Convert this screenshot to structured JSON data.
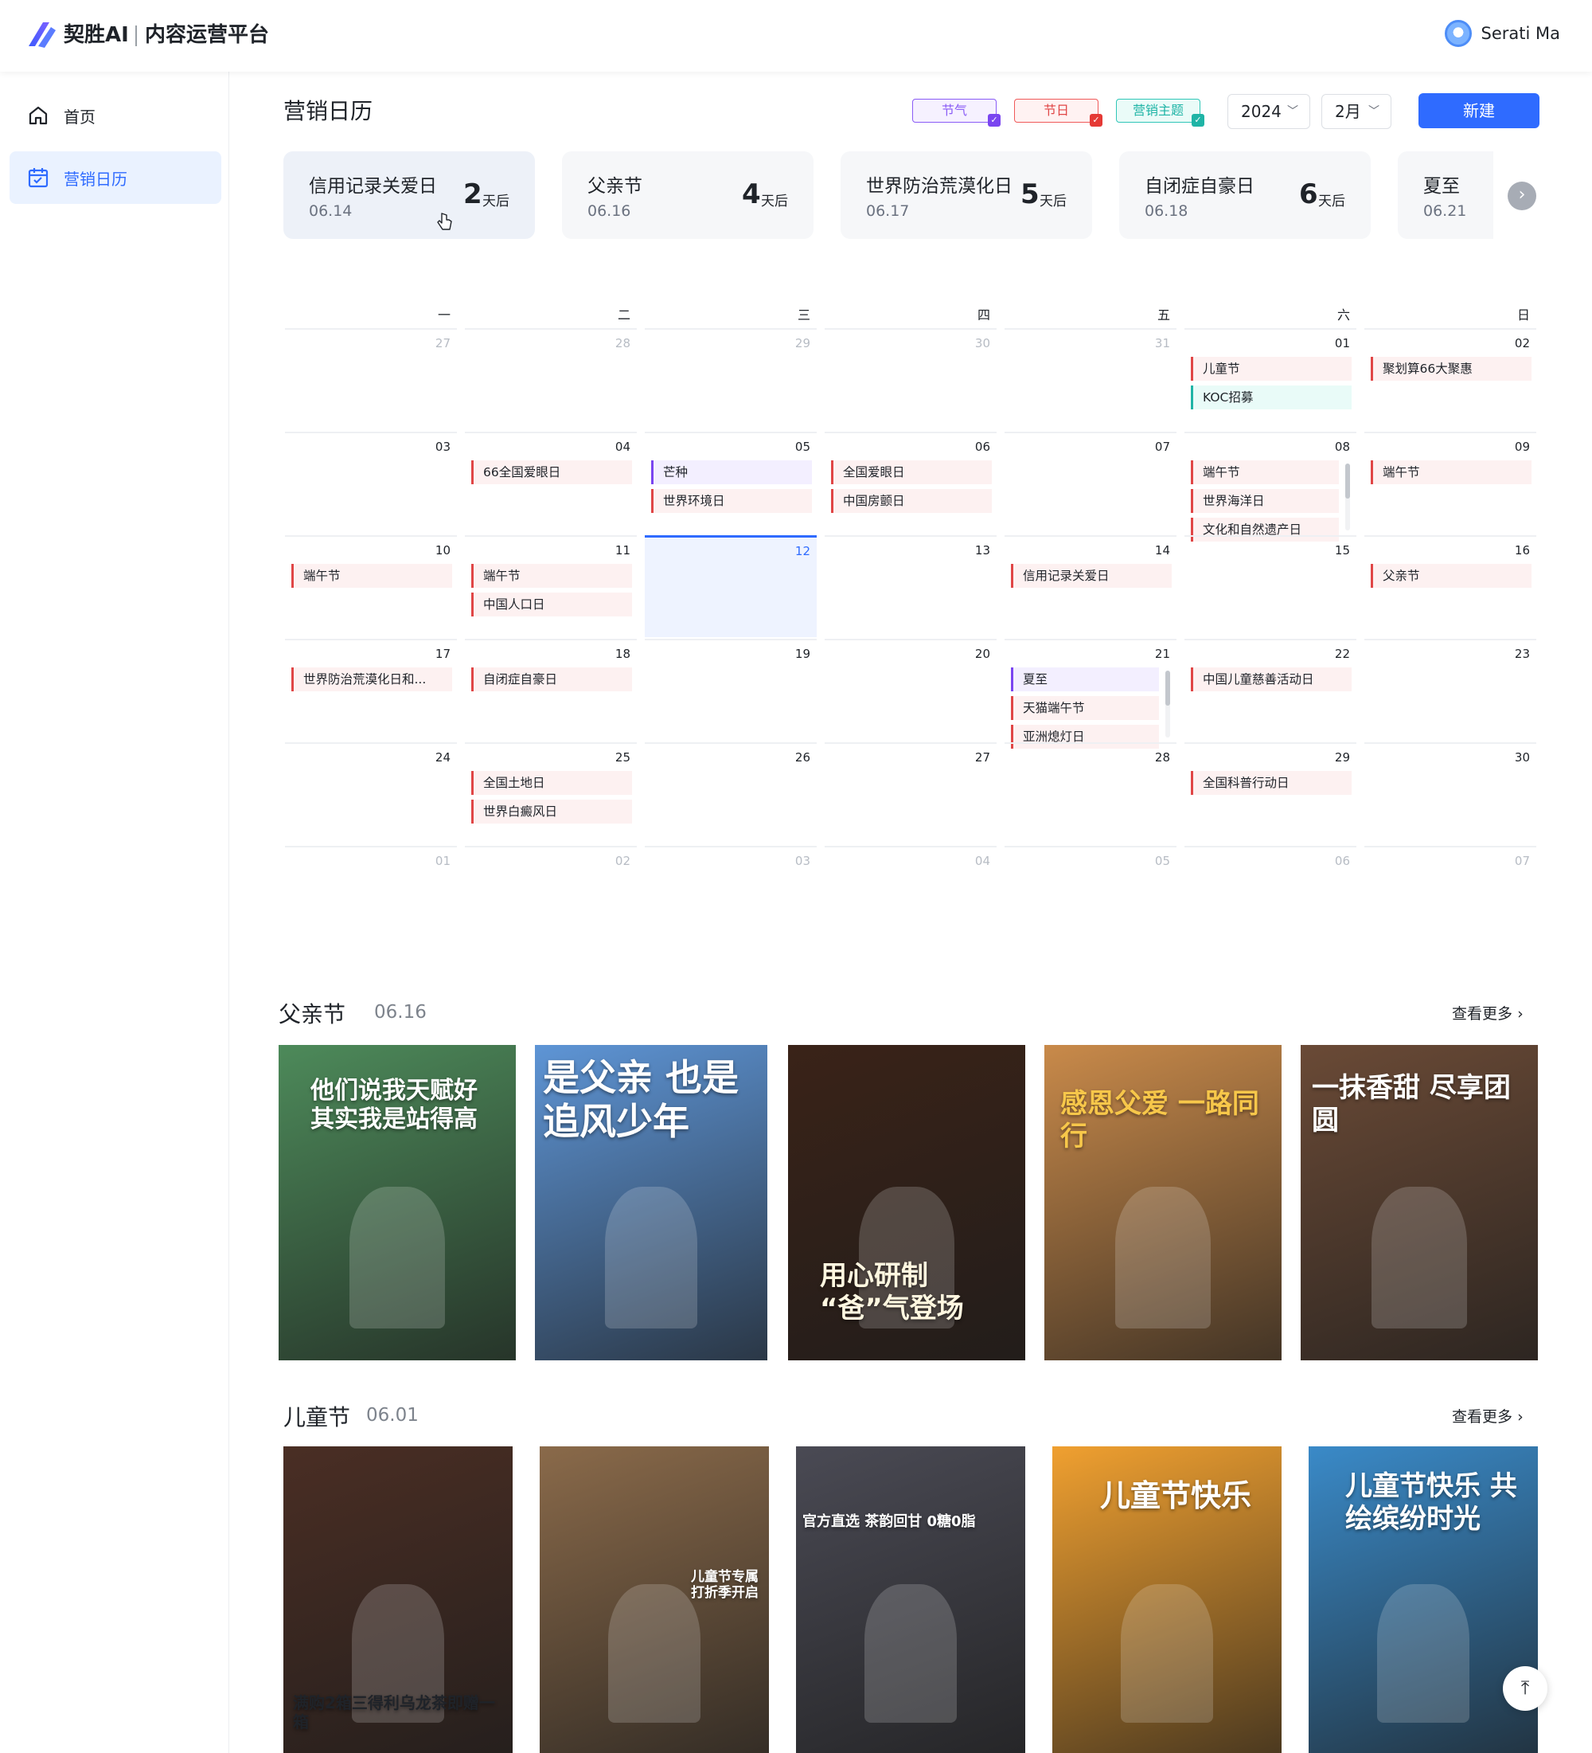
{
  "header": {
    "brand": "契胜AI",
    "platform": "内容运营平台",
    "user_name": "Serati Ma"
  },
  "sidebar": {
    "items": [
      {
        "label": "首页",
        "icon": "home-icon"
      },
      {
        "label": "营销日历",
        "icon": "calendar-icon",
        "active": true
      }
    ]
  },
  "page": {
    "title": "营销日历",
    "legend": [
      {
        "label": "节气",
        "color": "#7a45f0"
      },
      {
        "label": "节日",
        "color": "#e53935"
      },
      {
        "label": "营销主题",
        "color": "#1fb4a6"
      }
    ],
    "year": "2024",
    "month": "2月",
    "new_button": "新建"
  },
  "countdown": [
    {
      "name": "信用记录关爱日",
      "date": "06.14",
      "days": "2",
      "unit": "天后"
    },
    {
      "name": "父亲节",
      "date": "06.16",
      "days": "4",
      "unit": "天后"
    },
    {
      "name": "世界防治荒漠化日",
      "date": "06.17",
      "days": "5",
      "unit": "天后"
    },
    {
      "name": "自闭症自豪日",
      "date": "06.18",
      "days": "6",
      "unit": "天后"
    },
    {
      "name": "夏至",
      "date": "06.21",
      "days": "",
      "unit": ""
    }
  ],
  "calendar": {
    "weekdays": [
      "一",
      "二",
      "三",
      "四",
      "五",
      "六",
      "日"
    ],
    "weeks": [
      [
        {
          "day": "27",
          "other": true,
          "events": []
        },
        {
          "day": "28",
          "other": true,
          "events": []
        },
        {
          "day": "29",
          "other": true,
          "events": []
        },
        {
          "day": "30",
          "other": true,
          "events": []
        },
        {
          "day": "31",
          "other": true,
          "events": []
        },
        {
          "day": "01",
          "events": [
            {
              "t": "儿童节",
              "c": "red"
            },
            {
              "t": "KOC招募",
              "c": "teal"
            }
          ]
        },
        {
          "day": "02",
          "events": [
            {
              "t": "聚划算66大聚惠",
              "c": "red"
            }
          ]
        }
      ],
      [
        {
          "day": "03",
          "events": []
        },
        {
          "day": "04",
          "events": [
            {
              "t": "66全国爱眼日",
              "c": "red"
            }
          ]
        },
        {
          "day": "05",
          "events": [
            {
              "t": "芒种",
              "c": "purple"
            },
            {
              "t": "世界环境日",
              "c": "red"
            }
          ]
        },
        {
          "day": "06",
          "events": [
            {
              "t": "全国爱眼日",
              "c": "red"
            },
            {
              "t": "中国房颤日",
              "c": "red"
            }
          ]
        },
        {
          "day": "07",
          "events": []
        },
        {
          "day": "08",
          "scroll": true,
          "events": [
            {
              "t": "端午节",
              "c": "red"
            },
            {
              "t": "世界海洋日",
              "c": "red"
            },
            {
              "t": "文化和自然遗产日",
              "c": "red"
            }
          ]
        },
        {
          "day": "09",
          "events": [
            {
              "t": "端午节",
              "c": "red"
            }
          ]
        }
      ],
      [
        {
          "day": "10",
          "events": [
            {
              "t": "端午节",
              "c": "red"
            }
          ]
        },
        {
          "day": "11",
          "events": [
            {
              "t": "端午节",
              "c": "red"
            },
            {
              "t": "中国人口日",
              "c": "red"
            }
          ]
        },
        {
          "day": "12",
          "today": true,
          "events": []
        },
        {
          "day": "13",
          "events": []
        },
        {
          "day": "14",
          "events": [
            {
              "t": "信用记录关爱日",
              "c": "red"
            }
          ]
        },
        {
          "day": "15",
          "events": []
        },
        {
          "day": "16",
          "events": [
            {
              "t": "父亲节",
              "c": "red"
            }
          ]
        }
      ],
      [
        {
          "day": "17",
          "events": [
            {
              "t": "世界防治荒漠化日和...",
              "c": "red"
            }
          ]
        },
        {
          "day": "18",
          "events": [
            {
              "t": "自闭症自豪日",
              "c": "red"
            }
          ]
        },
        {
          "day": "19",
          "events": []
        },
        {
          "day": "20",
          "events": []
        },
        {
          "day": "21",
          "scroll": true,
          "events": [
            {
              "t": "夏至",
              "c": "purple"
            },
            {
              "t": "天猫端午节",
              "c": "red"
            },
            {
              "t": "亚洲熄灯日",
              "c": "red"
            }
          ]
        },
        {
          "day": "22",
          "events": [
            {
              "t": "中国儿童慈善活动日",
              "c": "red"
            }
          ]
        },
        {
          "day": "23",
          "events": []
        }
      ],
      [
        {
          "day": "24",
          "events": []
        },
        {
          "day": "25",
          "events": [
            {
              "t": "全国土地日",
              "c": "red"
            },
            {
              "t": "世界白癜风日",
              "c": "red"
            }
          ]
        },
        {
          "day": "26",
          "events": []
        },
        {
          "day": "27",
          "events": []
        },
        {
          "day": "28",
          "events": []
        },
        {
          "day": "29",
          "events": [
            {
              "t": "全国科普行动日",
              "c": "red"
            }
          ]
        },
        {
          "day": "30",
          "events": []
        }
      ],
      [
        {
          "day": "01",
          "other": true,
          "events": []
        },
        {
          "day": "02",
          "other": true,
          "events": []
        },
        {
          "day": "03",
          "other": true,
          "events": []
        },
        {
          "day": "04",
          "other": true,
          "events": []
        },
        {
          "day": "05",
          "other": true,
          "events": []
        },
        {
          "day": "06",
          "other": true,
          "events": []
        },
        {
          "day": "07",
          "other": true,
          "events": []
        }
      ]
    ]
  },
  "sections": [
    {
      "title": "父亲节",
      "date": "06.16",
      "more": "查看更多",
      "posters": [
        {
          "text": "他们说我天赋好 其实我是站得高",
          "bg": "#4d8a5a"
        },
        {
          "text": "是父亲 也是追风少年",
          "bg": "#5e95d6"
        },
        {
          "text": "用心研制 “爸”气登场",
          "bg": "#3a2318"
        },
        {
          "text": "感恩父爱 一路同行",
          "bg": "#c98a4a"
        },
        {
          "text": "一抹香甜 尽享团圆",
          "bg": "#6a4a36"
        }
      ]
    },
    {
      "title": "儿童节",
      "date": "06.01",
      "more": "查看更多",
      "posters": [
        {
          "text": "满购2箱三得利乌龙茶即赠一箱",
          "bg": "#4a2e24"
        },
        {
          "text": "儿童节专属 打折季开启",
          "bg": "#8a6a4a"
        },
        {
          "text": "官方直选 茶韵回甘 0糖0脂",
          "bg": "#4a4a54"
        },
        {
          "text": "儿童节快乐",
          "bg": "#f0a030"
        },
        {
          "text": "儿童节快乐 共绘缤纷时光",
          "bg": "#3a8ac8"
        }
      ]
    }
  ]
}
